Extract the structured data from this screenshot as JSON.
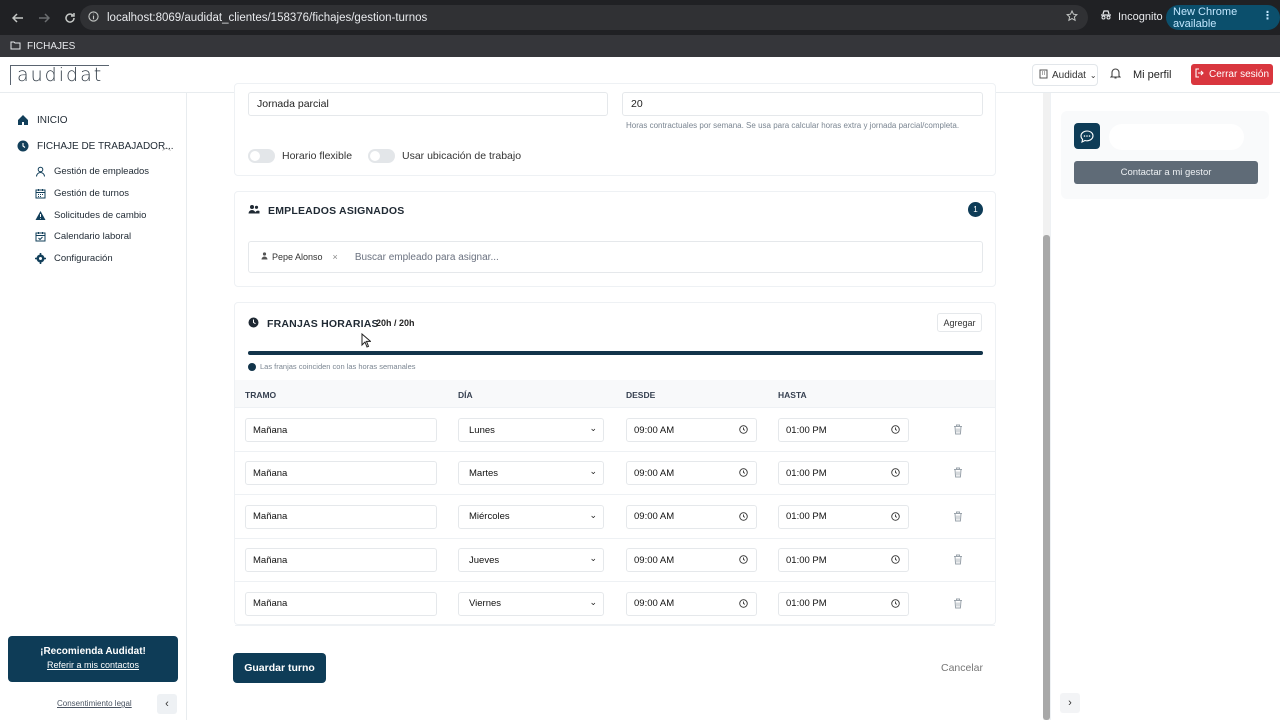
{
  "browser": {
    "url": "localhost:8069/audidat_clientes/158376/fichajes/gestion-turnos",
    "incognito_label": "Incognito",
    "update_label": "New Chrome available",
    "bookmark_folder": "FICHAJES"
  },
  "header": {
    "logo_text": "audidat",
    "company": "Audidat",
    "profile": "Mi perfil",
    "logout": "Cerrar sesión"
  },
  "sidebar": {
    "home": "INICIO",
    "section": "FICHAJE DE TRABAJADOR...",
    "items": [
      {
        "label": "Gestión de empleados",
        "icon": "user-icon"
      },
      {
        "label": "Gestión de turnos",
        "icon": "calendar-icon"
      },
      {
        "label": "Solicitudes de cambio",
        "icon": "warning-icon"
      },
      {
        "label": "Calendario laboral",
        "icon": "calendar-check-icon"
      },
      {
        "label": "Configuración",
        "icon": "gear-icon"
      }
    ],
    "recommend_title": "¡Recomienda Audidat!",
    "recommend_link": "Referir a mis contactos",
    "consent": "Consentimiento legal"
  },
  "form": {
    "contract_type": "Jornada parcial",
    "weekly_hours": "20",
    "weekly_hours_hint": "Horas contractuales por semana. Se usa para calcular horas extra y jornada parcial/completa.",
    "flex_label": "Horario flexible",
    "location_label": "Usar ubicación de trabajo"
  },
  "employees": {
    "title": "EMPLEADOS ASIGNADOS",
    "count": "1",
    "assigned": "Pepe Alonso",
    "remove": "×",
    "search_placeholder": "Buscar empleado para asignar..."
  },
  "slots": {
    "title": "FRANJAS HORARIAS",
    "hours": "20h / 20h",
    "progress_fraction": 1.0,
    "add_label": "Agregar",
    "match_note": "Las franjas coinciden con las horas semanales",
    "headers": {
      "tramo": "TRAMO",
      "dia": "DÍA",
      "desde": "DESDE",
      "hasta": "HASTA"
    },
    "rows": [
      {
        "tramo": "Mañana",
        "dia": "Lunes",
        "desde": "09:00 AM",
        "hasta": "01:00 PM"
      },
      {
        "tramo": "Mañana",
        "dia": "Martes",
        "desde": "09:00 AM",
        "hasta": "01:00 PM"
      },
      {
        "tramo": "Mañana",
        "dia": "Miércoles",
        "desde": "09:00 AM",
        "hasta": "01:00 PM"
      },
      {
        "tramo": "Mañana",
        "dia": "Jueves",
        "desde": "09:00 AM",
        "hasta": "01:00 PM"
      },
      {
        "tramo": "Mañana",
        "dia": "Viernes",
        "desde": "09:00 AM",
        "hasta": "01:00 PM"
      }
    ]
  },
  "actions": {
    "save": "Guardar turno",
    "cancel": "Cancelar"
  },
  "right_panel": {
    "contact": "Contactar a mi gestor"
  },
  "colors": {
    "brand": "#0e3c57",
    "danger": "#d9363e",
    "chrome_dark": "#202124"
  }
}
